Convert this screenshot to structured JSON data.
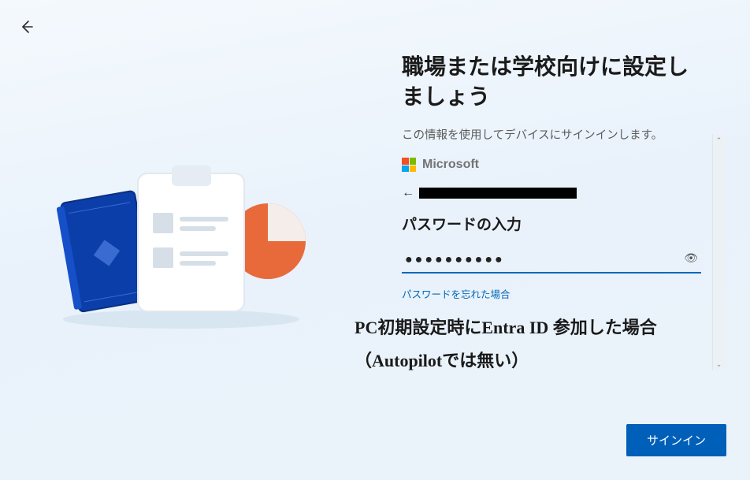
{
  "back_label": "戻る",
  "title": "職場または学校向けに設定しましょう",
  "subtitle": "この情報を使用してデバイスにサインインします。",
  "ms_brand": "Microsoft",
  "identity_back": "←",
  "pw_heading": "パスワードの入力",
  "pw_value": "●●●●●●●●●●",
  "reveal_glyph": "👁",
  "forgot_pw": "パスワードを忘れた場合",
  "annotation_line1": "PC初期設定時にEntra ID 参加した場合",
  "annotation_line2": "（Autopilotでは無い）",
  "signin_label": "サインイン",
  "scroll_up": "⌃",
  "scroll_down": "⌄"
}
